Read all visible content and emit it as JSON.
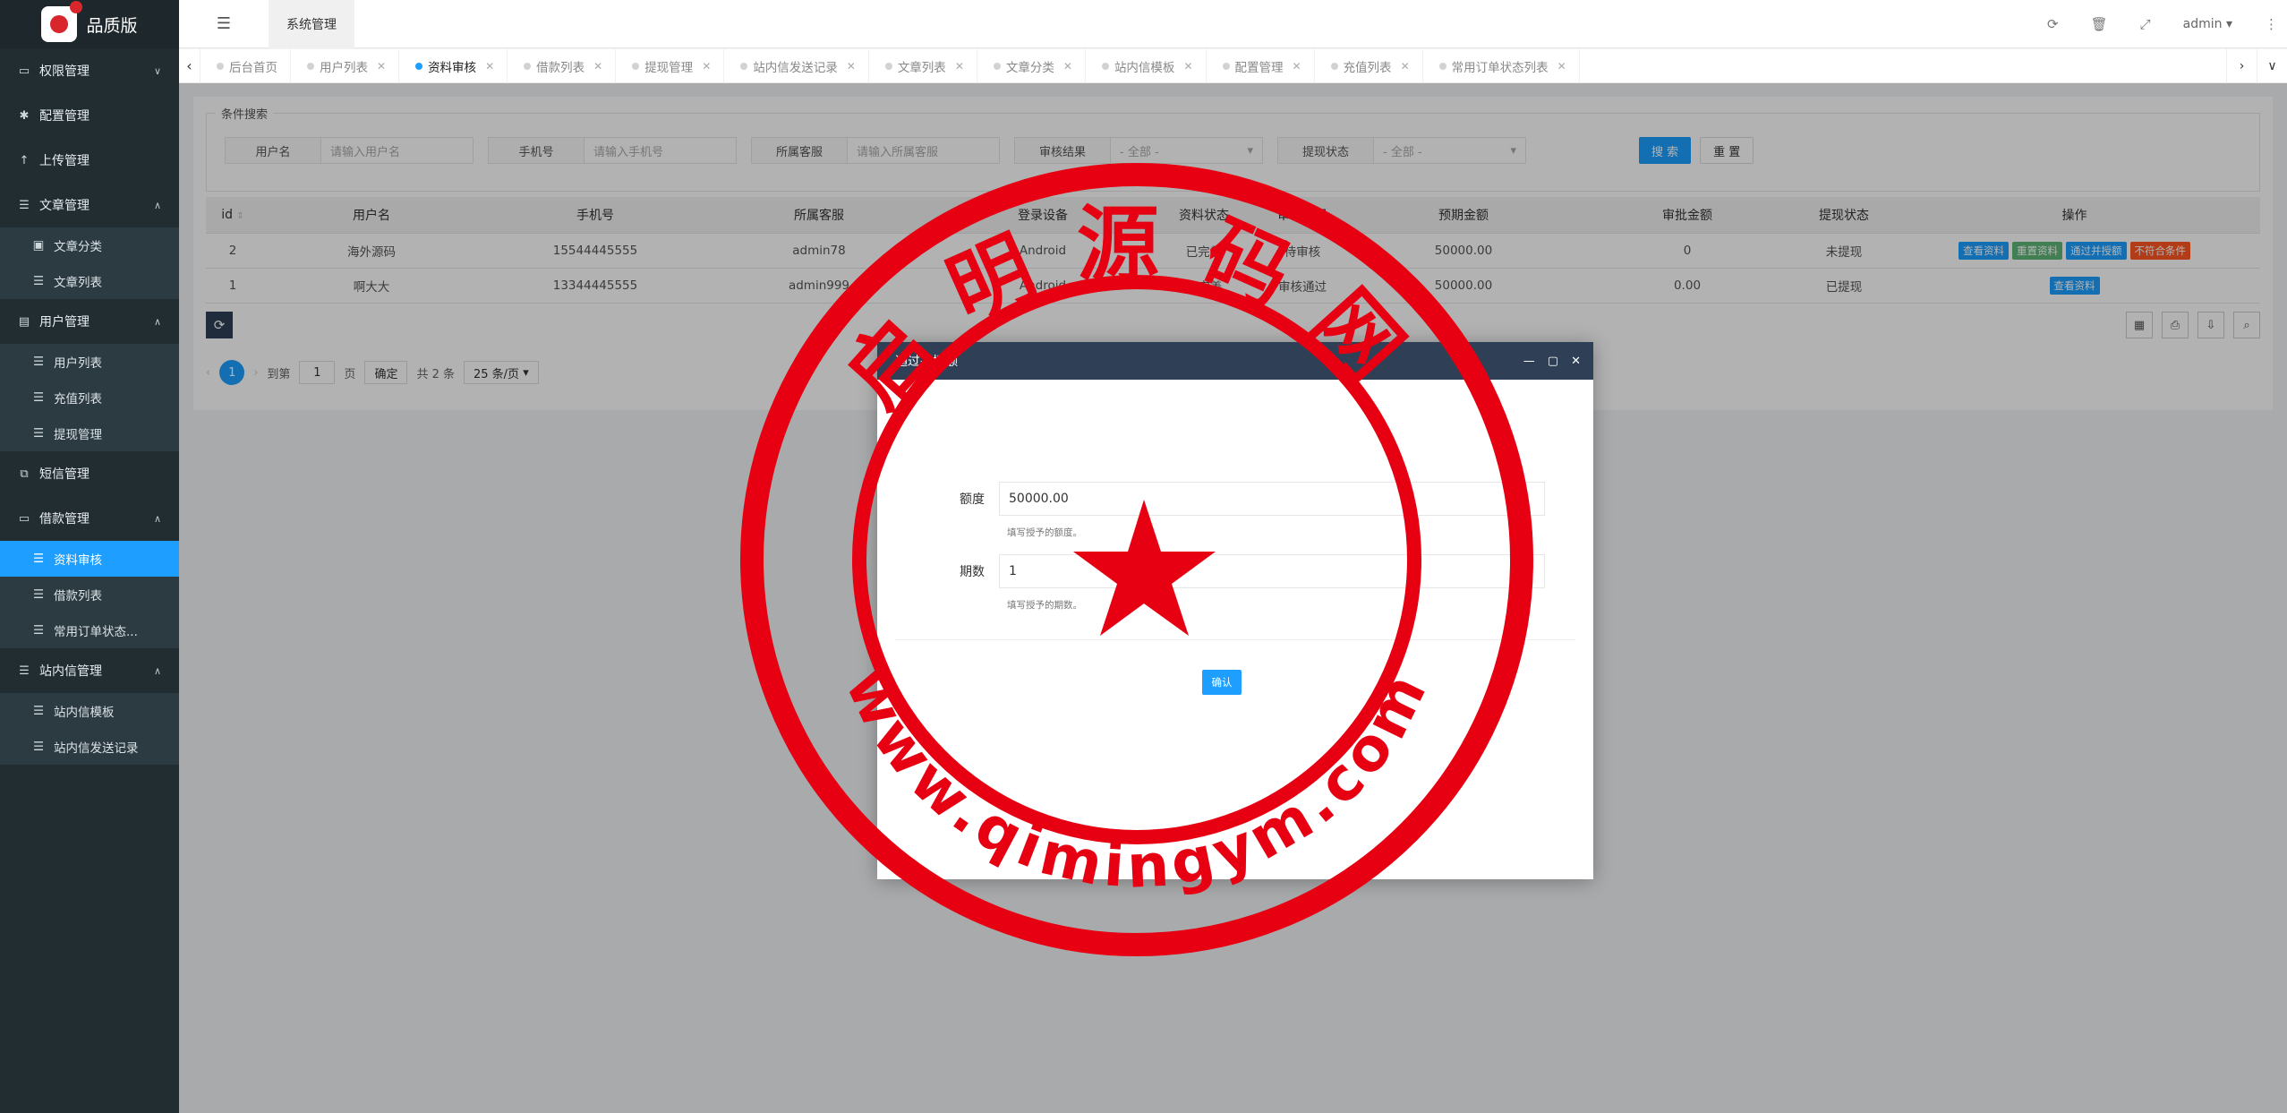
{
  "app": {
    "logo_small": "超级盘",
    "brand": "品质版"
  },
  "header": {
    "system_tab": "系统管理",
    "user": "admin"
  },
  "sidebar": {
    "items": [
      {
        "label": "权限管理",
        "icon": "laptop-icon",
        "arrow": "﹀"
      },
      {
        "label": "配置管理",
        "icon": "gear-icon"
      },
      {
        "label": "上传管理",
        "icon": "upload-icon"
      },
      {
        "label": "文章管理",
        "icon": "list-icon",
        "arrow": "︿"
      },
      {
        "label": "用户管理",
        "icon": "user-icon",
        "arrow": "︿"
      },
      {
        "label": "短信管理",
        "icon": "copy-icon"
      },
      {
        "label": "借款管理",
        "icon": "money-icon",
        "arrow": "︿"
      },
      {
        "label": "站内信管理",
        "icon": "list-icon",
        "arrow": "︿"
      }
    ],
    "article_sub": [
      "文章分类",
      "文章列表"
    ],
    "user_sub": [
      "用户列表",
      "充值列表",
      "提现管理"
    ],
    "loan_sub": [
      "资料审核",
      "借款列表",
      "常用订单状态..."
    ],
    "msg_sub": [
      "站内信模板",
      "站内信发送记录"
    ]
  },
  "tabs": [
    {
      "label": "后台首页",
      "closable": false
    },
    {
      "label": "用户列表"
    },
    {
      "label": "资料审核",
      "active": true
    },
    {
      "label": "借款列表"
    },
    {
      "label": "提现管理"
    },
    {
      "label": "站内信发送记录"
    },
    {
      "label": "文章列表"
    },
    {
      "label": "文章分类"
    },
    {
      "label": "站内信模板"
    },
    {
      "label": "配置管理"
    },
    {
      "label": "充值列表"
    },
    {
      "label": "常用订单状态列表"
    }
  ],
  "search": {
    "legend": "条件搜索",
    "username_label": "用户名",
    "username_placeholder": "请输入用户名",
    "phone_label": "手机号",
    "phone_placeholder": "请输入手机号",
    "service_label": "所属客服",
    "service_placeholder": "请输入所属客服",
    "audit_label": "审核结果",
    "audit_value": "- 全部 -",
    "withdraw_label": "提现状态",
    "withdraw_value": "- 全部 -",
    "search_btn": "搜 索",
    "reset_btn": "重 置"
  },
  "table": {
    "headers": [
      "id",
      "用户名",
      "手机号",
      "所属客服",
      "登录设备",
      "资料状态",
      "审核结果",
      "预期金额",
      "审批金额",
      "提现状态",
      "操作"
    ],
    "rows": [
      {
        "id": "2",
        "username": "海外源码",
        "phone": "15544445555",
        "service": "admin78",
        "device": "Android",
        "info": "已完善",
        "audit": "待审核",
        "expected": "50000.00",
        "approved": "0",
        "withdraw": "未提现",
        "ops": [
          {
            "label": "查看资料",
            "color": "blue"
          },
          {
            "label": "重置资料",
            "color": "green"
          },
          {
            "label": "通过并授额",
            "color": "blue"
          },
          {
            "label": "不符合条件",
            "color": "red"
          }
        ]
      },
      {
        "id": "1",
        "username": "啊大大",
        "phone": "13344445555",
        "service": "admin999",
        "device": "Android",
        "info": "已完善",
        "audit": "审核通过",
        "expected": "50000.00",
        "approved": "0.00",
        "withdraw": "已提现",
        "ops": [
          {
            "label": "查看资料",
            "color": "blue"
          }
        ]
      }
    ]
  },
  "pager": {
    "current": "1",
    "goto_label": "到第",
    "page_value": "1",
    "page_unit": "页",
    "confirm": "确定",
    "total": "共 2 条",
    "per_page": "25 条/页"
  },
  "modal": {
    "title": "通过并授额",
    "amount_label": "额度",
    "amount_value": "50000.00",
    "amount_hint": "填写授予的额度。",
    "term_label": "期数",
    "term_value": "1",
    "term_hint": "填写授予的期数。",
    "confirm": "确认"
  },
  "stamp": {
    "top_text": "启明源码网",
    "bottom_text": "www.qimingym.com",
    "color": "#e60012"
  }
}
